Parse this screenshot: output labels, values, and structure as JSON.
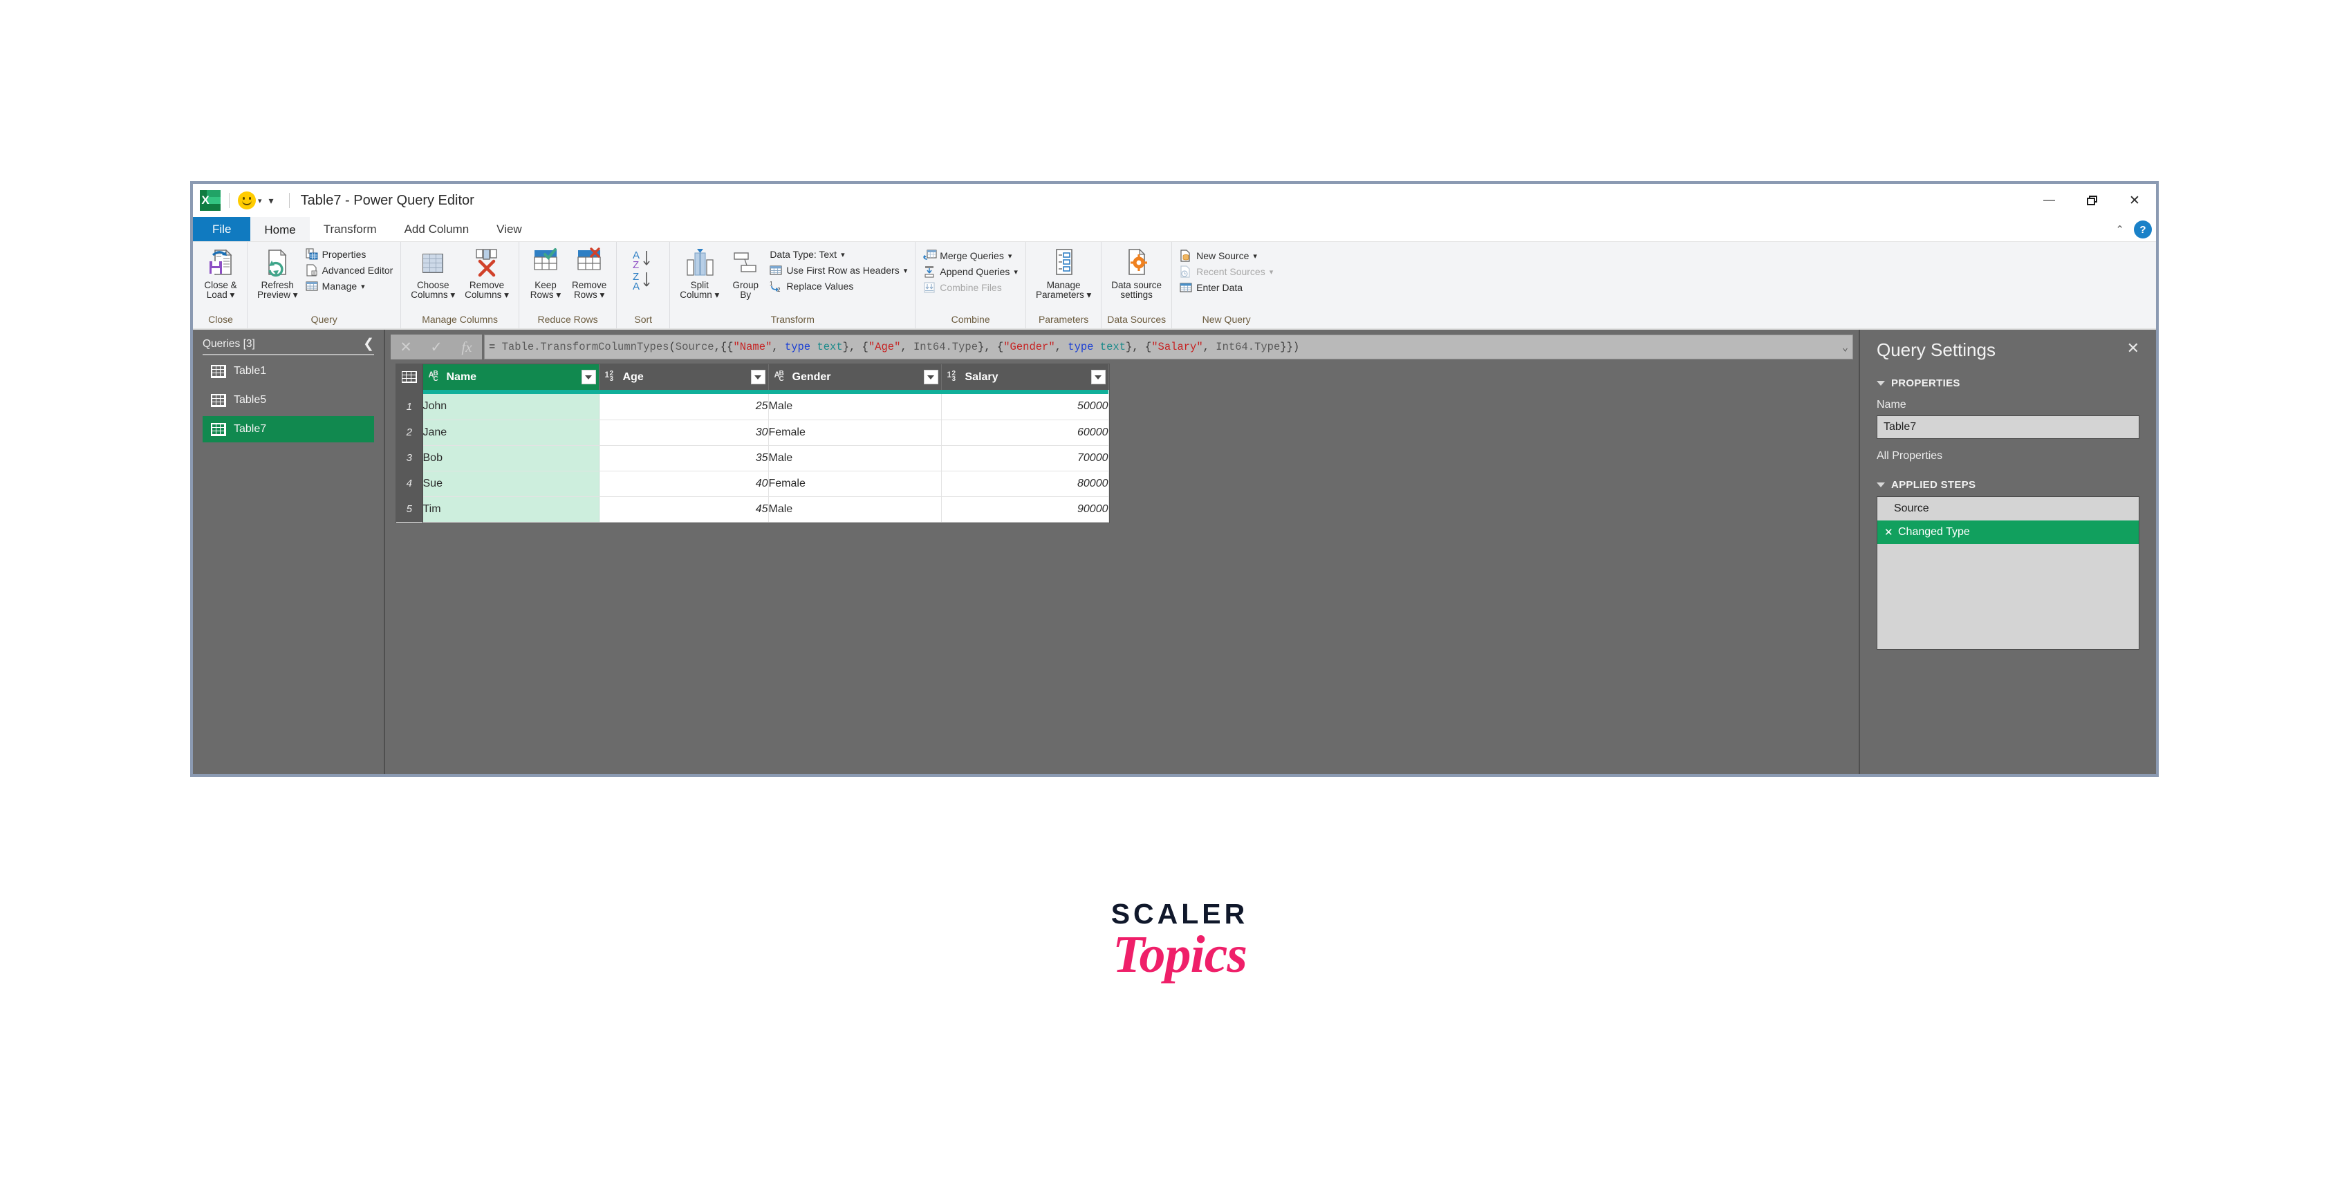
{
  "window": {
    "title": "Table7 - Power Query Editor",
    "app_icon": "excel-icon",
    "qat_smiley": "smiley-icon",
    "minimize": "minimize-icon",
    "restore": "restore-icon",
    "close": "close-icon",
    "collapse_ribbon": "chevron-up-icon",
    "help": "?"
  },
  "tabs": [
    {
      "label": "File",
      "state": "file"
    },
    {
      "label": "Home",
      "state": "active"
    },
    {
      "label": "Transform",
      "state": "normal"
    },
    {
      "label": "Add Column",
      "state": "normal"
    },
    {
      "label": "View",
      "state": "normal"
    }
  ],
  "ribbon": {
    "groups": [
      {
        "label": "Close",
        "big": [
          {
            "label_1": "Close &",
            "label_2": "Load",
            "has_caret": true,
            "icon": "close-and-load-icon"
          }
        ],
        "small": []
      },
      {
        "label": "Query",
        "big": [
          {
            "label_1": "Refresh",
            "label_2": "Preview",
            "has_caret": true,
            "icon": "refresh-preview-icon"
          }
        ],
        "small": [
          {
            "label": "Properties",
            "icon": "properties-icon",
            "caret": false,
            "disabled": false
          },
          {
            "label": "Advanced Editor",
            "icon": "advanced-editor-icon",
            "caret": false,
            "disabled": false
          },
          {
            "label": "Manage",
            "icon": "manage-icon",
            "caret": true,
            "disabled": false
          }
        ]
      },
      {
        "label": "Manage Columns",
        "big": [
          {
            "label_1": "Choose",
            "label_2": "Columns",
            "has_caret": true,
            "icon": "choose-columns-icon"
          },
          {
            "label_1": "Remove",
            "label_2": "Columns",
            "has_caret": true,
            "icon": "remove-columns-icon"
          }
        ],
        "small": []
      },
      {
        "label": "Reduce Rows",
        "big": [
          {
            "label_1": "Keep",
            "label_2": "Rows",
            "has_caret": true,
            "icon": "keep-rows-icon"
          },
          {
            "label_1": "Remove",
            "label_2": "Rows",
            "has_caret": true,
            "icon": "remove-rows-icon"
          }
        ],
        "small": []
      },
      {
        "label": "Sort",
        "big": [
          {
            "label_1": "",
            "label_2": "",
            "has_caret": false,
            "icon": "sort-az-za-icon"
          }
        ],
        "small": []
      },
      {
        "label": "Transform",
        "big": [
          {
            "label_1": "Split",
            "label_2": "Column",
            "has_caret": true,
            "icon": "split-column-icon"
          },
          {
            "label_1": "Group",
            "label_2": "By",
            "has_caret": false,
            "icon": "group-by-icon"
          }
        ],
        "small": [
          {
            "label": "Data Type: Text",
            "icon": "data-type-icon",
            "caret": true,
            "disabled": false
          },
          {
            "label": "Use First Row as Headers",
            "icon": "first-row-headers-icon",
            "caret": true,
            "disabled": false
          },
          {
            "label": "Replace Values",
            "icon": "replace-values-icon",
            "caret": false,
            "disabled": false
          }
        ]
      },
      {
        "label": "Combine",
        "big": [],
        "small": [
          {
            "label": "Merge Queries",
            "icon": "merge-queries-icon",
            "caret": true,
            "disabled": false
          },
          {
            "label": "Append Queries",
            "icon": "append-queries-icon",
            "caret": true,
            "disabled": false
          },
          {
            "label": "Combine Files",
            "icon": "combine-files-icon",
            "caret": false,
            "disabled": true
          }
        ]
      },
      {
        "label": "Parameters",
        "big": [
          {
            "label_1": "Manage",
            "label_2": "Parameters",
            "has_caret": true,
            "icon": "manage-parameters-icon"
          }
        ],
        "small": []
      },
      {
        "label": "Data Sources",
        "big": [
          {
            "label_1": "Data source",
            "label_2": "settings",
            "has_caret": false,
            "icon": "data-source-settings-icon"
          }
        ],
        "small": []
      },
      {
        "label": "New Query",
        "big": [],
        "small": [
          {
            "label": "New Source",
            "icon": "new-source-icon",
            "caret": true,
            "disabled": false
          },
          {
            "label": "Recent Sources",
            "icon": "recent-sources-icon",
            "caret": true,
            "disabled": true
          },
          {
            "label": "Enter Data",
            "icon": "enter-data-icon",
            "caret": false,
            "disabled": false
          }
        ]
      }
    ]
  },
  "queries_pane": {
    "header": "Queries [3]",
    "collapse_icon": "chevron-left-icon",
    "items": [
      {
        "label": "Table1",
        "selected": false
      },
      {
        "label": "Table5",
        "selected": false
      },
      {
        "label": "Table7",
        "selected": true
      }
    ]
  },
  "formula_bar": {
    "cancel_icon": "cancel-icon",
    "confirm_icon": "checkmark-icon",
    "fx_icon": "fx-icon",
    "dropdown_icon": "chevron-down-icon",
    "tokens": [
      {
        "t": "= ",
        "c": "eq"
      },
      {
        "t": "Table.TransformColumnTypes",
        "c": "fn"
      },
      {
        "t": "(",
        "c": "pl"
      },
      {
        "t": "Source",
        "c": "fn"
      },
      {
        "t": ",{{",
        "c": "pl"
      },
      {
        "t": "\"Name\"",
        "c": "str"
      },
      {
        "t": ", ",
        "c": "pl"
      },
      {
        "t": "type",
        "c": "kw"
      },
      {
        "t": " ",
        "c": "pl"
      },
      {
        "t": "text",
        "c": "typ"
      },
      {
        "t": "}, {",
        "c": "pl"
      },
      {
        "t": "\"Age\"",
        "c": "str"
      },
      {
        "t": ", ",
        "c": "pl"
      },
      {
        "t": "Int64.Type",
        "c": "fn"
      },
      {
        "t": "}, {",
        "c": "pl"
      },
      {
        "t": "\"Gender\"",
        "c": "str"
      },
      {
        "t": ", ",
        "c": "pl"
      },
      {
        "t": "type",
        "c": "kw"
      },
      {
        "t": " ",
        "c": "pl"
      },
      {
        "t": "text",
        "c": "typ"
      },
      {
        "t": "}, {",
        "c": "pl"
      },
      {
        "t": "\"Salary\"",
        "c": "str"
      },
      {
        "t": ", ",
        "c": "pl"
      },
      {
        "t": "Int64.Type",
        "c": "fn"
      },
      {
        "t": "}})",
        "c": "pl"
      }
    ],
    "plain": "= Table.TransformColumnTypes(Source,{{\"Name\", type text}, {\"Age\", Int64.Type}, {\"Gender\", type text}, {\"Salary\", Int64.Type}})"
  },
  "table": {
    "corner_icon": "select-all-icon",
    "columns": [
      {
        "name": "Name",
        "type_icon": "ABC",
        "selected": true,
        "align": "left"
      },
      {
        "name": "Age",
        "type_icon": "123",
        "selected": false,
        "align": "right"
      },
      {
        "name": "Gender",
        "type_icon": "ABC",
        "selected": false,
        "align": "left"
      },
      {
        "name": "Salary",
        "type_icon": "123",
        "selected": false,
        "align": "right"
      }
    ],
    "rows": [
      {
        "n": "1",
        "Name": "John",
        "Age": "25",
        "Gender": "Male",
        "Salary": "50000"
      },
      {
        "n": "2",
        "Name": "Jane",
        "Age": "30",
        "Gender": "Female",
        "Salary": "60000"
      },
      {
        "n": "3",
        "Name": "Bob",
        "Age": "35",
        "Gender": "Male",
        "Salary": "70000"
      },
      {
        "n": "4",
        "Name": "Sue",
        "Age": "40",
        "Gender": "Female",
        "Salary": "80000"
      },
      {
        "n": "5",
        "Name": "Tim",
        "Age": "45",
        "Gender": "Male",
        "Salary": "90000"
      }
    ]
  },
  "query_settings": {
    "title": "Query Settings",
    "close_icon": "close-icon",
    "properties_section": "PROPERTIES",
    "name_label": "Name",
    "name_value": "Table7",
    "all_properties": "All Properties",
    "applied_steps_section": "APPLIED STEPS",
    "steps": [
      {
        "label": "Source",
        "selected": false,
        "has_delete": false
      },
      {
        "label": "Changed Type",
        "selected": true,
        "has_delete": true,
        "delete_icon": "delete-step-icon"
      }
    ]
  },
  "logo": {
    "line1": "SCALER",
    "line2": "Topics"
  },
  "colors": {
    "accent_green": "#11894f",
    "teal_bar": "#11b09a",
    "selection_fill": "#cdeedd",
    "header_gray": "#595959",
    "pane_gray": "#6b6b6b",
    "file_tab_blue": "#107ac0",
    "brand_pink": "#ef1f69",
    "brand_navy": "#10182b"
  }
}
